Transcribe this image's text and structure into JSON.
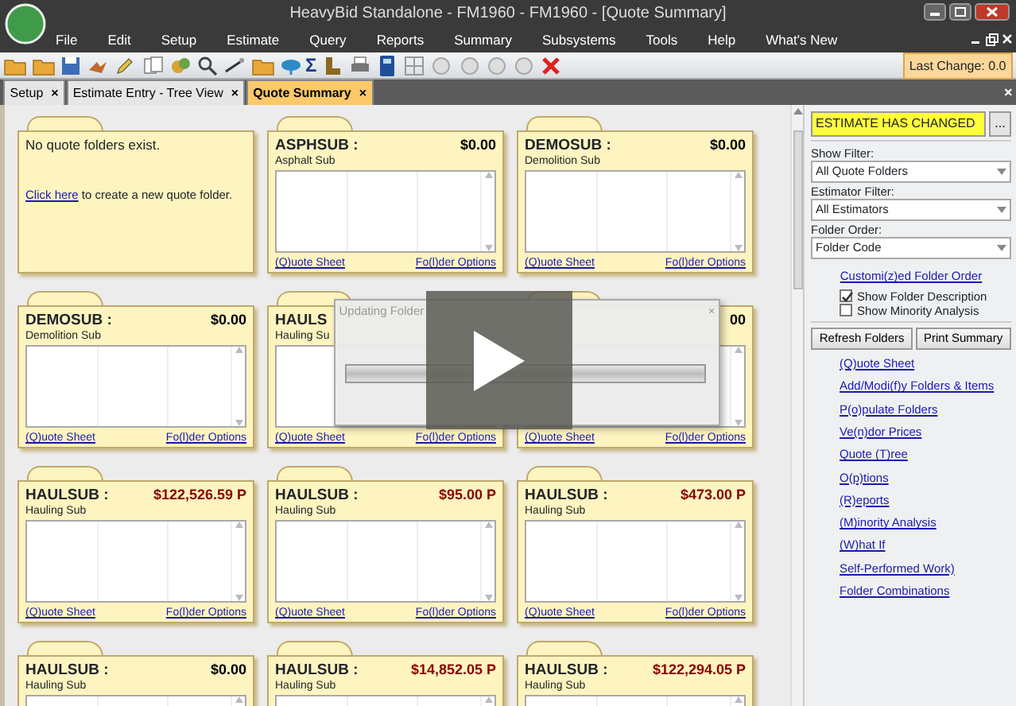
{
  "window": {
    "title": "HeavyBid Standalone - FM1960 - FM1960  - [Quote Summary]"
  },
  "menu": [
    "File",
    "Edit",
    "Setup",
    "Estimate",
    "Query",
    "Reports",
    "Summary",
    "Subsystems",
    "Tools",
    "Help",
    "What's New"
  ],
  "toolbar": {
    "sigma": "Σ",
    "last_change": "Last Change: 0.0"
  },
  "tabs": [
    {
      "label": "Setup",
      "close": "×",
      "selected": false
    },
    {
      "label": "Estimate Entry - Tree View",
      "close": "×",
      "selected": false
    },
    {
      "label": "Quote Summary",
      "close": "×",
      "selected": true
    }
  ],
  "tab_strip_close": "×",
  "cards": [
    {
      "kind": "empty",
      "message": "No quote folders exist.",
      "link_text": "Click here",
      "link_suffix": " to create a new quote folder."
    },
    {
      "kind": "folder",
      "code": "ASPHSUB :",
      "amount": "$0.00",
      "flagged": false,
      "description": "Asphalt Sub",
      "links": [
        "(Q)uote Sheet",
        "Fo(l)der Options"
      ]
    },
    {
      "kind": "folder",
      "code": "DEMOSUB :",
      "amount": "$0.00",
      "flagged": false,
      "description": "Demolition Sub",
      "links": [
        "(Q)uote Sheet",
        "Fo(l)der Options"
      ]
    },
    {
      "kind": "folder",
      "code": "DEMOSUB :",
      "amount": "$0.00",
      "flagged": false,
      "description": "Demolition Sub",
      "links": [
        "(Q)uote Sheet",
        "Fo(l)der Options"
      ]
    },
    {
      "kind": "folder",
      "code": "HAULS",
      "description": "Hauling Su",
      "links": [
        "(Q)uote Sheet",
        "Fo(l)der Options"
      ]
    },
    {
      "kind": "folder",
      "amount": "00",
      "flagged": false,
      "links": [
        "(Q)uote Sheet",
        "Fo(l)der Options"
      ]
    },
    {
      "kind": "folder",
      "code": "HAULSUB :",
      "amount": "$122,526.59 P",
      "flagged": true,
      "description": "Hauling Sub",
      "links": [
        "(Q)uote Sheet",
        "Fo(l)der Options"
      ]
    },
    {
      "kind": "folder",
      "code": "HAULSUB :",
      "amount": "$95.00 P",
      "flagged": true,
      "description": "Hauling Sub",
      "links": [
        "(Q)uote Sheet",
        "Fo(l)der Options"
      ]
    },
    {
      "kind": "folder",
      "code": "HAULSUB :",
      "amount": "$473.00 P",
      "flagged": true,
      "description": "Hauling Sub",
      "links": [
        "(Q)uote Sheet",
        "Fo(l)der Options"
      ]
    },
    {
      "kind": "folder",
      "code": "HAULSUB :",
      "amount": "$0.00",
      "flagged": false,
      "description": "Hauling Sub"
    },
    {
      "kind": "folder",
      "code": "HAULSUB :",
      "amount": "$14,852.05 P",
      "flagged": true,
      "description": "Hauling Sub"
    },
    {
      "kind": "folder",
      "code": "HAULSUB :",
      "amount": "$122,294.05 P",
      "flagged": true,
      "description": "Hauling Sub"
    }
  ],
  "dialog": {
    "title": "Updating Folder",
    "close": "×",
    "level": 1
  },
  "panel": {
    "status": "ESTIMATE HAS CHANGED",
    "status_button": "...",
    "filters": [
      {
        "label": "Show Filter:",
        "value": "All Quote Folders"
      },
      {
        "label": "Estimator Filter:",
        "value": "All Estimators"
      },
      {
        "label": "Folder Order:",
        "value": "Folder Code"
      }
    ],
    "order_link": "Customi(z)ed Folder Order",
    "checkboxes": [
      {
        "label": "Show Folder Description",
        "checked": true
      },
      {
        "label": "Show Minority Analysis",
        "checked": false
      }
    ],
    "buttons": [
      "Refresh Folders",
      "Print Summary"
    ],
    "links": [
      "(Q)uote Sheet",
      "Add/Modi(f)y Folders & Items",
      "P(o)pulate Folders",
      "Ve(n)dor Prices",
      "Quote (T)ree",
      "O(p)tions",
      "(R)eports",
      "(M)inority Analysis",
      "(W)hat If",
      "Self-Performed Work)",
      "Folder Combinations"
    ]
  }
}
